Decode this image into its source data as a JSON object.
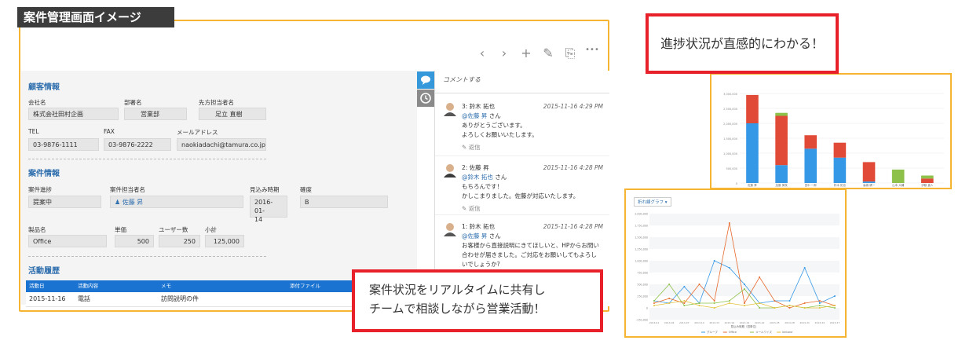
{
  "title_tag": "案件管理画面イメージ",
  "toolbar": {
    "prev_icon": "‹",
    "next_icon": "›",
    "add_icon": "+",
    "edit_icon": "✎",
    "copy_icon": "⎘",
    "more_icon": "•••"
  },
  "customer": {
    "section_title": "顧客情報",
    "company_label": "会社名",
    "company_value": "株式会社田村企画",
    "dept_label": "部署名",
    "dept_value": "営業部",
    "contact_label": "先方担当者名",
    "contact_value": "足立 直樹",
    "tel_label": "TEL",
    "tel_value": "03-9876-1111",
    "fax_label": "FAX",
    "fax_value": "03-9876-2222",
    "email_label": "メールアドレス",
    "email_value": "naokiadachi@tamura.co.jp"
  },
  "deal": {
    "section_title": "案件情報",
    "progress_label": "案件進捗",
    "progress_value": "提案中",
    "owner_label": "案件担当者名",
    "owner_value": "佐藤 昇",
    "due_label": "見込み時期",
    "due_value_1": "2016-01-",
    "due_value_2": "14",
    "confidence_label": "確度",
    "confidence_value": "B",
    "product_label": "製品名",
    "product_value": "Office",
    "unit_label": "単価",
    "unit_value": "500",
    "users_label": "ユーザー数",
    "users_value": "250",
    "subtotal_label": "小計",
    "subtotal_value": "125,000"
  },
  "activity": {
    "section_title": "活動履歴",
    "col_date": "活動日",
    "col_content": "活動内容",
    "col_memo": "メモ",
    "col_file": "添付ファイル",
    "row_date": "2015-11-16",
    "row_content": "電話",
    "row_memo": "訪問説明の件"
  },
  "comments": {
    "prompt": "コメントする",
    "reply_label": "返信",
    "items": [
      {
        "head": "3: 鈴木 拓也",
        "date": "2015-11-16 4:29 PM",
        "mention": "@佐藤 昇",
        "suffix": " さん",
        "lines": [
          "ありがとうございます。",
          "よろしくお願いいたします。"
        ]
      },
      {
        "head": "2: 佐藤 昇",
        "date": "2015-11-16 4:28 PM",
        "mention": "@鈴木 拓也",
        "suffix": " さん",
        "lines": [
          "もちろんです！",
          "かしこまりました。佐藤が対応いたします。"
        ]
      },
      {
        "head": "1: 鈴木 拓也",
        "date": "2015-11-16 4:28 PM",
        "mention": "@佐藤 昇",
        "suffix": " さん",
        "lines": [
          "お客様から直接説明にきてほしいと、HPからお問い",
          "合わせが届きました。ご対応をお願いしてもよろし",
          "いでしょうか?"
        ]
      }
    ]
  },
  "callout_top": "進捗状況が直感的にわかる！",
  "callout_bottom_1": "案件状況をリアルタイムに共有し",
  "callout_bottom_2": "チームで相談しながら営業活動！",
  "chart_data": [
    {
      "type": "bar",
      "stacked": true,
      "ylim": [
        0,
        3000000
      ],
      "yticks": [
        "3,000,000",
        "2,500,000",
        "2,000,000",
        "1,500,000",
        "1,000,000",
        "500,000",
        "0"
      ],
      "categories": [
        "佐藤 昇",
        "加藤 美咲",
        "田中 一郎",
        "鈴木 拓也",
        "高橋 健一",
        "山本 大輔",
        "伊藤 直人"
      ],
      "series": [
        {
          "color": "#3498e6",
          "values": [
            2000000,
            600000,
            1150000,
            850000,
            50000,
            0,
            0
          ]
        },
        {
          "color": "#e04a36",
          "values": [
            950000,
            1650000,
            450000,
            500000,
            650000,
            0,
            150000
          ]
        },
        {
          "color": "#8dc14a",
          "values": [
            0,
            100000,
            0,
            0,
            0,
            450000,
            100000
          ]
        }
      ],
      "grid": true
    },
    {
      "type": "line",
      "title": "折れ線グラフ",
      "ylim": [
        -250000,
        2000000
      ],
      "yticks": [
        "2,000,000",
        "1,750,000",
        "1,500,000",
        "1,250,000",
        "1,000,000",
        "750,000",
        "500,000",
        "250,000",
        "0",
        "-250,000"
      ],
      "x": [
        "2013-01",
        "2013-04",
        "2013-07",
        "2013-10",
        "2013-13",
        "2013-16",
        "2013-19",
        "2013-22",
        "2013-25",
        "2013-28",
        "2013-31",
        "2013-34",
        "2013-37"
      ],
      "xlabel": "見込み時期（週単位）",
      "legend": [
        "グループ",
        "Office",
        "メールワイズ",
        "kintone"
      ],
      "series": [
        {
          "color": "#3498e6",
          "values": [
            150000,
            100000,
            450000,
            100000,
            1000000,
            850000,
            500000,
            100000,
            150000,
            150000,
            850000,
            100000,
            250000
          ]
        },
        {
          "color": "#e66a2c",
          "values": [
            100000,
            200000,
            100000,
            500000,
            150000,
            1800000,
            100000,
            650000,
            150000,
            0,
            100000,
            150000,
            50000
          ]
        },
        {
          "color": "#8dc14a",
          "values": [
            150000,
            500000,
            50000,
            100000,
            100000,
            150000,
            400000,
            0,
            0,
            50000,
            0,
            50000,
            0
          ]
        },
        {
          "color": "#e0c23a",
          "values": [
            50000,
            100000,
            150000,
            50000,
            0,
            100000,
            50000,
            100000,
            0,
            50000,
            0,
            0,
            50000
          ]
        }
      ],
      "grid": true,
      "legend_position": "bottom"
    }
  ]
}
